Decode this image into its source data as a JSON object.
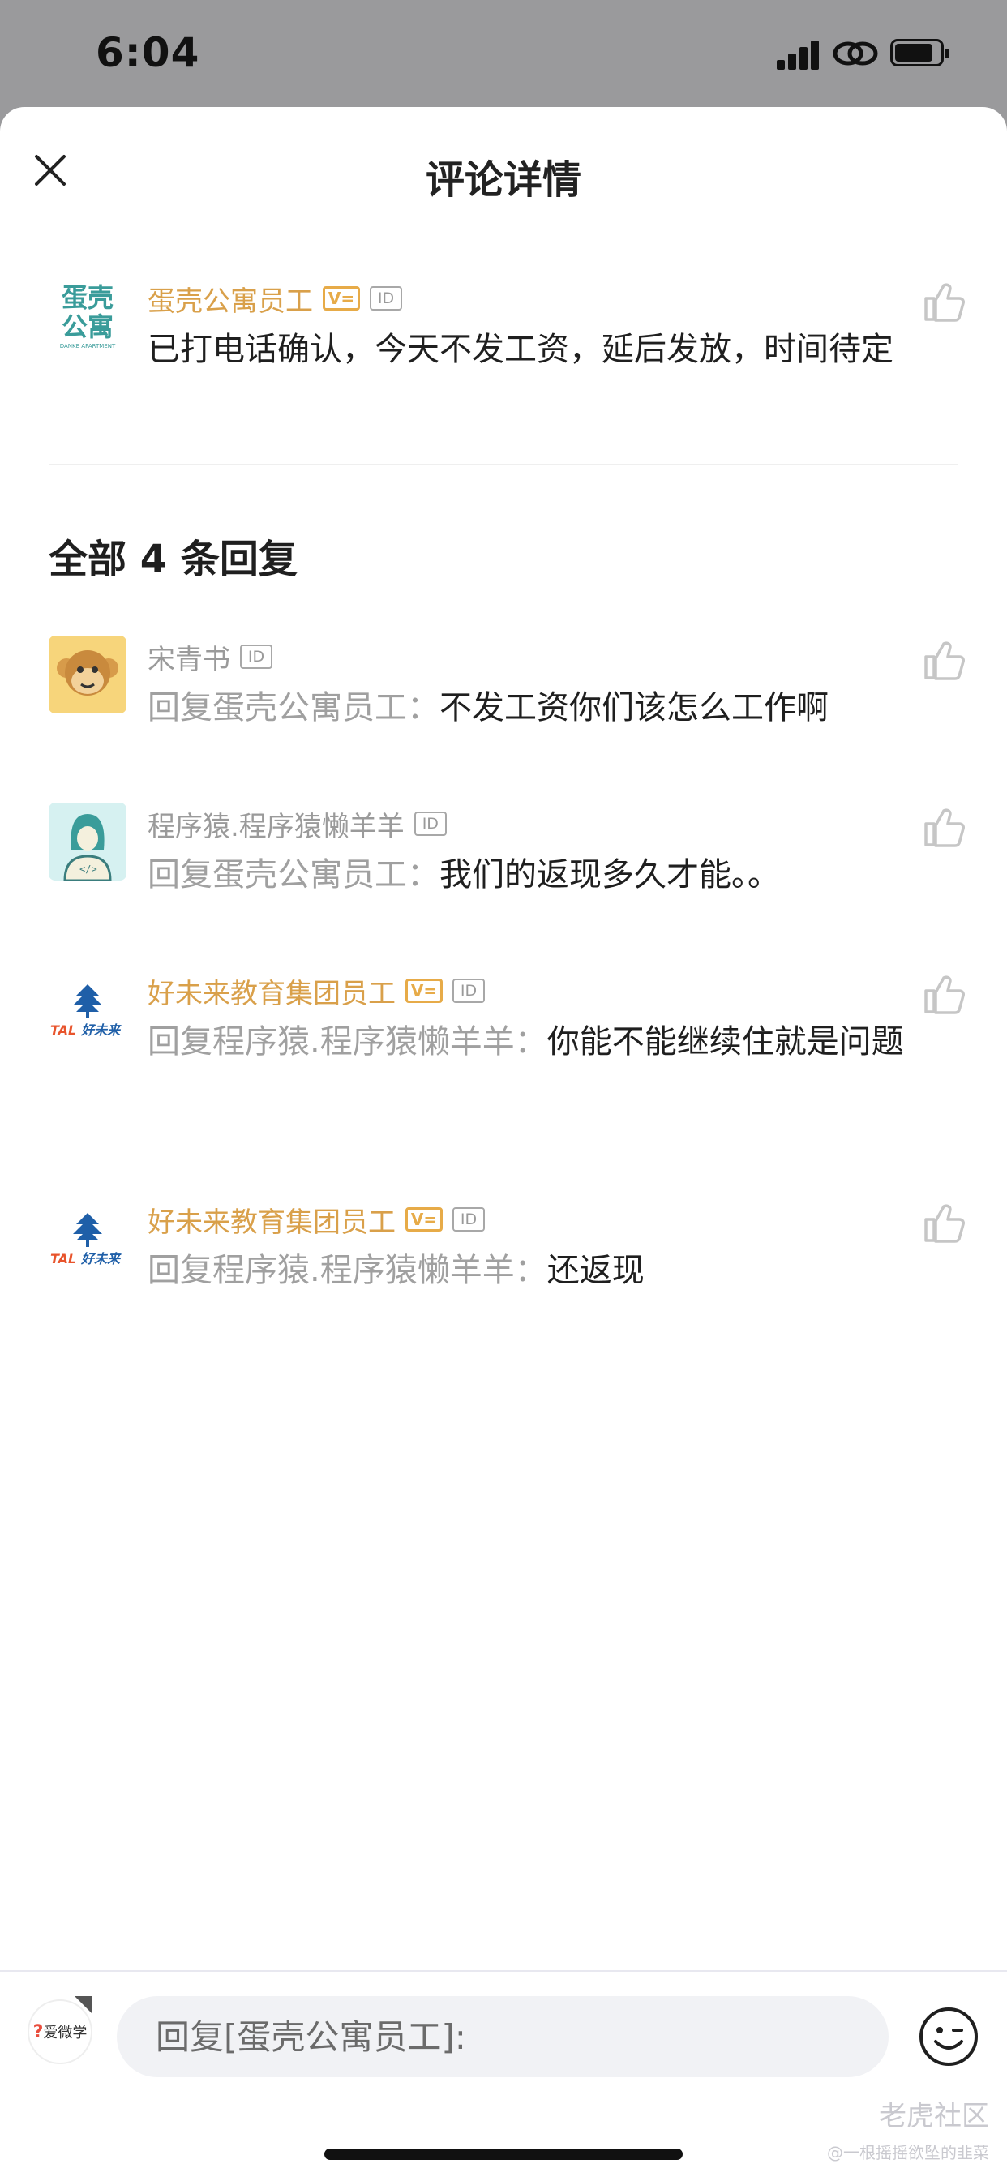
{
  "status_bar": {
    "time": "6:04"
  },
  "header": {
    "title": "评论详情"
  },
  "main_comment": {
    "author": "蛋壳公寓员工",
    "verified_badge": "V=",
    "id_badge": "ID",
    "text": "已打电话确认，今天不发工资，延后发放，时间待定",
    "avatar_lines": [
      "蛋壳",
      "公寓"
    ],
    "avatar_sub": "DANKE APARTMENT"
  },
  "replies_heading": "全部 4 条回复",
  "replies": [
    {
      "author": "宋青书",
      "id_badge": "ID",
      "prefix": "回复蛋壳公寓员工：",
      "text": "不发工资你们该怎么工作啊"
    },
    {
      "author": "程序猿.程序猿懒羊羊",
      "id_badge": "ID",
      "prefix": "回复蛋壳公寓员工：",
      "text": "我们的返现多久才能。。"
    },
    {
      "author": "好未来教育集团员工",
      "verified_badge": "V=",
      "id_badge": "ID",
      "prefix": "回复程序猿.程序猿懒羊羊：",
      "text": "你能不能继续住就是问题"
    },
    {
      "author": "好未来教育集团员工",
      "verified_badge": "V=",
      "id_badge": "ID",
      "prefix": "回复程序猿.程序猿懒羊羊：",
      "text": "还返现"
    }
  ],
  "tal_logo": {
    "tal": "TAL",
    "name": "好未来"
  },
  "bottom_bar": {
    "reply_placeholder": "回复[蛋壳公寓员工]:",
    "app_logo_text": "爱微学"
  },
  "watermark": {
    "line1": "老虎社区",
    "line2": "@一根摇摇欲坠的韭菜"
  },
  "colors": {
    "verified_name": "#d9a04a",
    "muted": "#a0a0a0",
    "teal": "#3a9c9a",
    "tal_blue": "#1f5fa8"
  }
}
